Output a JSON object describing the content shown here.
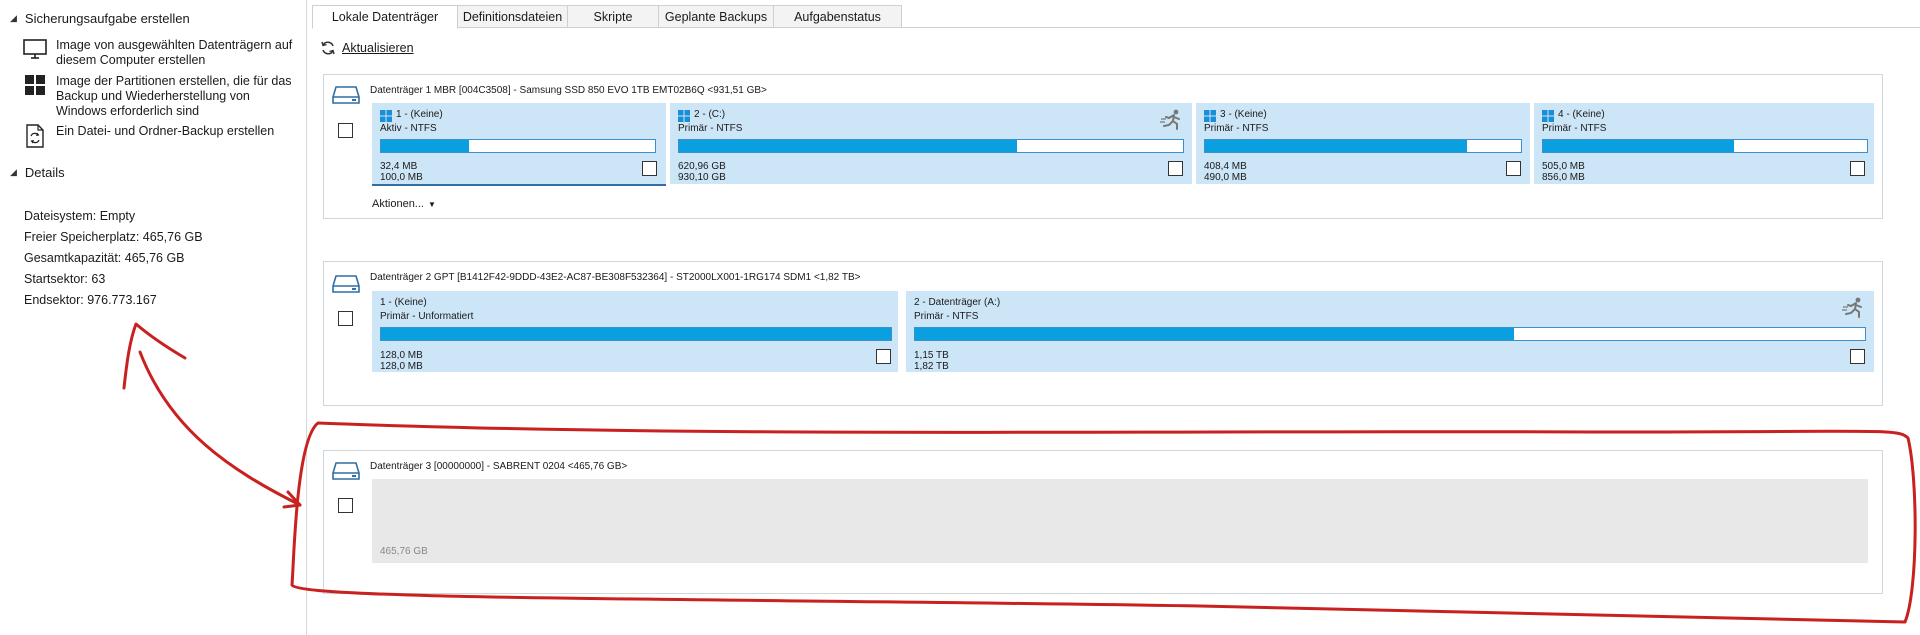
{
  "sidebar": {
    "section_create": "Sicherungsaufgabe erstellen",
    "tasks": [
      {
        "label": "Image von ausgewählten Datenträgern auf diesem Computer erstellen",
        "icon": "monitor-icon"
      },
      {
        "label": "Image der Partitionen erstellen, die für das Backup und Wiederherstellung von Windows erforderlich sind",
        "icon": "windows-icon"
      },
      {
        "label": "Ein Datei- und Ordner-Backup erstellen",
        "icon": "file-sync-icon"
      }
    ],
    "section_details": "Details",
    "details": [
      "Dateisystem: Empty",
      "Freier Speicherplatz: 465,76 GB",
      "Gesamtkapazität: 465,76 GB",
      "Startsektor: 63",
      "Endsektor: 976.773.167"
    ]
  },
  "tabs": [
    {
      "label": "Lokale Datenträger",
      "active": true
    },
    {
      "label": "Definitionsdateien",
      "active": false
    },
    {
      "label": "Skripte",
      "active": false
    },
    {
      "label": "Geplante Backups",
      "active": false
    },
    {
      "label": "Aufgabenstatus",
      "active": false
    }
  ],
  "refresh_label": "Aktualisieren",
  "disks": [
    {
      "title": "Datenträger 1 MBR [004C3508] - Samsung SSD 850 EVO 1TB EMT02B6Q  <931,51 GB>",
      "actions_label": "Aktionen...",
      "partitions": [
        {
          "label": "1 -  (Keine)",
          "type": "Aktiv - NTFS",
          "used": "32,4 MB",
          "total": "100,0 MB",
          "fill": 0.32
        },
        {
          "label": "2 -  (C:)",
          "type": "Primär - NTFS",
          "used": "620,96 GB",
          "total": "930,10 GB",
          "fill": 0.67
        },
        {
          "label": "3 -  (Keine)",
          "type": "Primär - NTFS",
          "used": "408,4 MB",
          "total": "490,0 MB",
          "fill": 0.83
        },
        {
          "label": "4 -  (Keine)",
          "type": "Primär - NTFS",
          "used": "505,0 MB",
          "total": "856,0 MB",
          "fill": 0.59
        }
      ]
    },
    {
      "title": "Datenträger 2 GPT [B1412F42-9DDD-43E2-AC87-BE308F532364] - ST2000LX001-1RG174 SDM1  <1,82 TB>",
      "partitions": [
        {
          "label": "1 -  (Keine)",
          "type": "Primär - Unformatiert",
          "used": "128,0 MB",
          "total": "128,0 MB",
          "fill": 1.0
        },
        {
          "label": "2 - Datenträger (A:)",
          "type": "Primär - NTFS",
          "used": "1,15 TB",
          "total": "1,82 TB",
          "fill": 0.63
        }
      ]
    },
    {
      "title": "Datenträger 3 [00000000] - SABRENT  0204  <465,76 GB>",
      "empty_size": "465,76 GB"
    }
  ],
  "colors": {
    "accent": "#0aa0e0",
    "partition_bg": "#cde6f7",
    "annotation": "#c8211f"
  }
}
